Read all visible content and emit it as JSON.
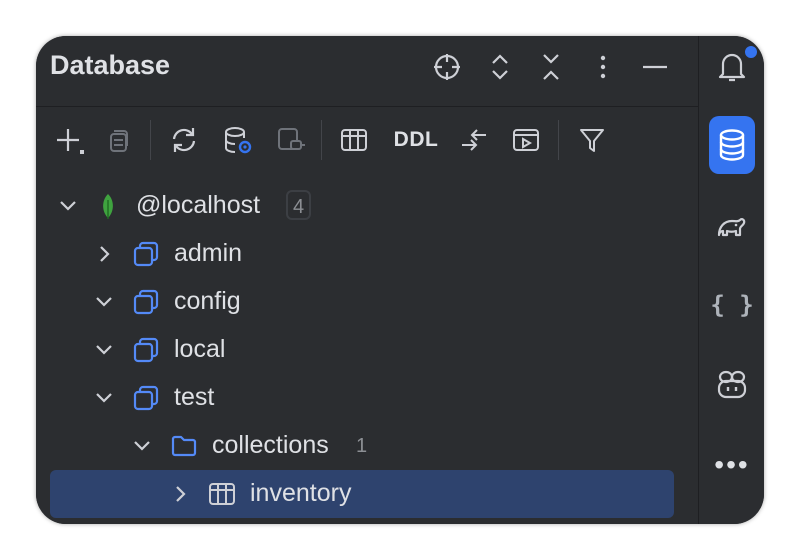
{
  "panel": {
    "title": "Database"
  },
  "toolbar": {
    "ddl_label": "DDL"
  },
  "tree": {
    "root": {
      "label": "@localhost",
      "count": "4",
      "expanded": true
    },
    "databases": [
      {
        "label": "admin",
        "expanded": false
      },
      {
        "label": "config",
        "expanded": true
      },
      {
        "label": "local",
        "expanded": true
      },
      {
        "label": "test",
        "expanded": true
      }
    ],
    "folder": {
      "label": "collections",
      "count": "1",
      "expanded": true
    },
    "collection": {
      "label": "inventory",
      "expanded": false,
      "selected": true
    }
  },
  "rightbar": {
    "items": [
      "notifications-icon",
      "database-icon",
      "gradle-icon",
      "json-icon",
      "copilot-icon",
      "more-icon"
    ],
    "braces_label": "{ }",
    "more_label": "•••"
  },
  "colors": {
    "background": "#2b2d30",
    "text": "#dfe1e5",
    "accent": "#3574f0",
    "selection": "#2e436e",
    "mongo_leaf": "#3fa33f"
  }
}
